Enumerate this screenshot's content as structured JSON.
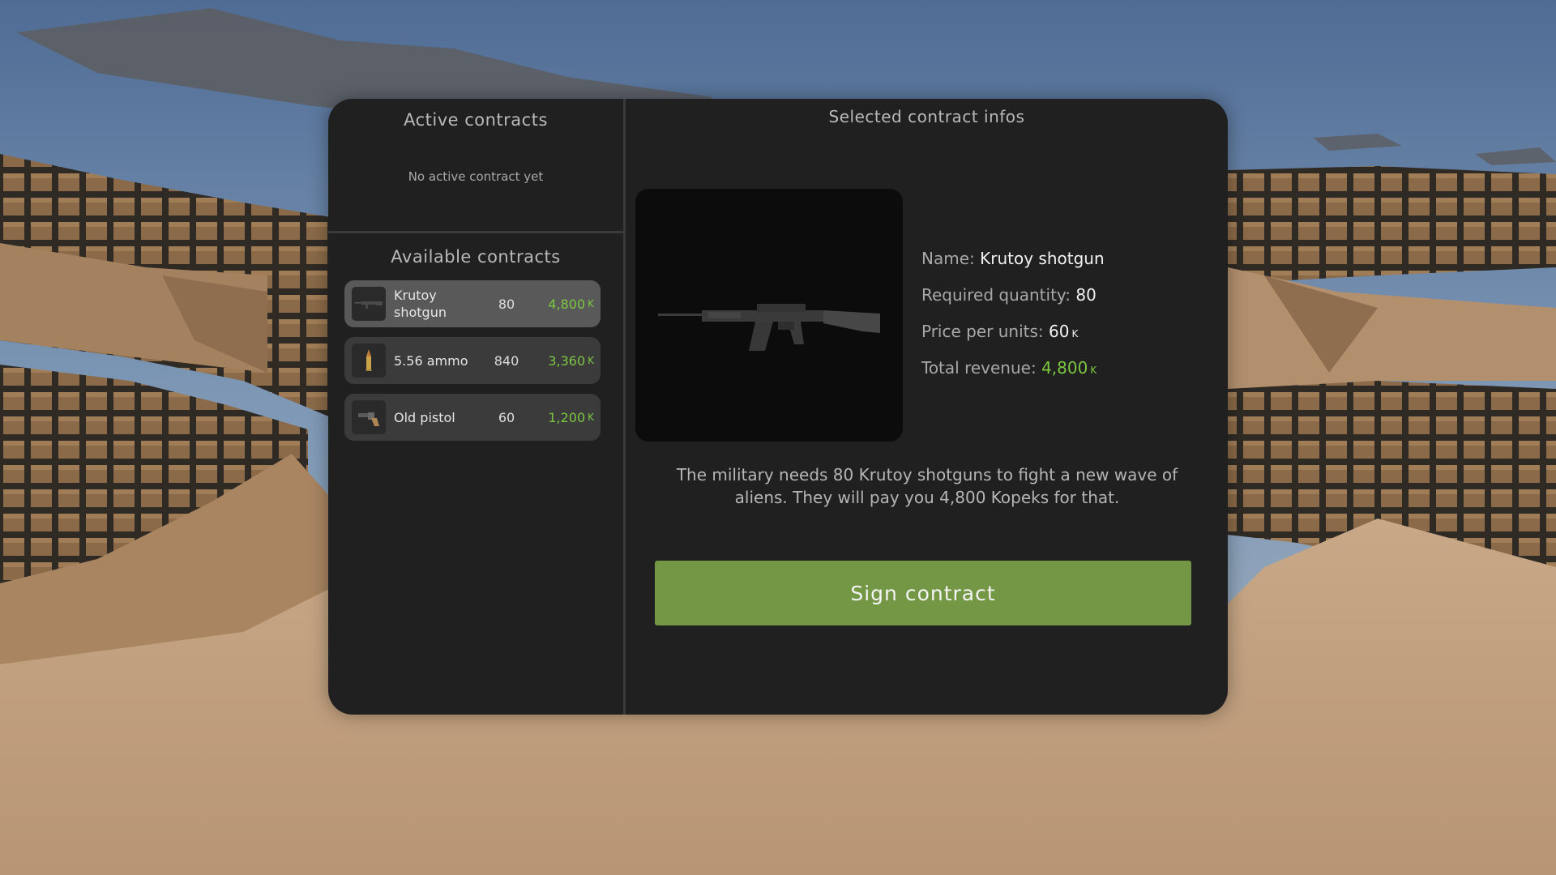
{
  "active_contracts": {
    "title": "Active contracts",
    "empty_text": "No active contract yet"
  },
  "available_contracts": {
    "title": "Available contracts",
    "items": [
      {
        "name": "Krutoy shotgun",
        "quantity": "80",
        "price": "4,800",
        "currency": "K",
        "icon": "shotgun-icon",
        "selected": true
      },
      {
        "name": "5.56 ammo",
        "quantity": "840",
        "price": "3,360",
        "currency": "K",
        "icon": "bullet-icon",
        "selected": false
      },
      {
        "name": "Old pistol",
        "quantity": "60",
        "price": "1,200",
        "currency": "K",
        "icon": "pistol-icon",
        "selected": false
      }
    ]
  },
  "selected_contract": {
    "title": "Selected contract infos",
    "name_label": "Name:",
    "name": "Krutoy shotgun",
    "quantity_label": "Required quantity:",
    "quantity": "80",
    "price_label": "Price per units:",
    "price": "60",
    "revenue_label": "Total revenue:",
    "revenue": "4,800",
    "currency": "K",
    "description": "The military needs 80 Krutoy shotguns to fight a new wave of aliens. They will pay you 4,800 Kopeks for that.",
    "sign_button": "Sign contract"
  },
  "colors": {
    "panel": "#202020",
    "selected_item": "#595959",
    "item": "#3b3b3b",
    "price_green": "#7cc742",
    "button_green": "#739744"
  }
}
